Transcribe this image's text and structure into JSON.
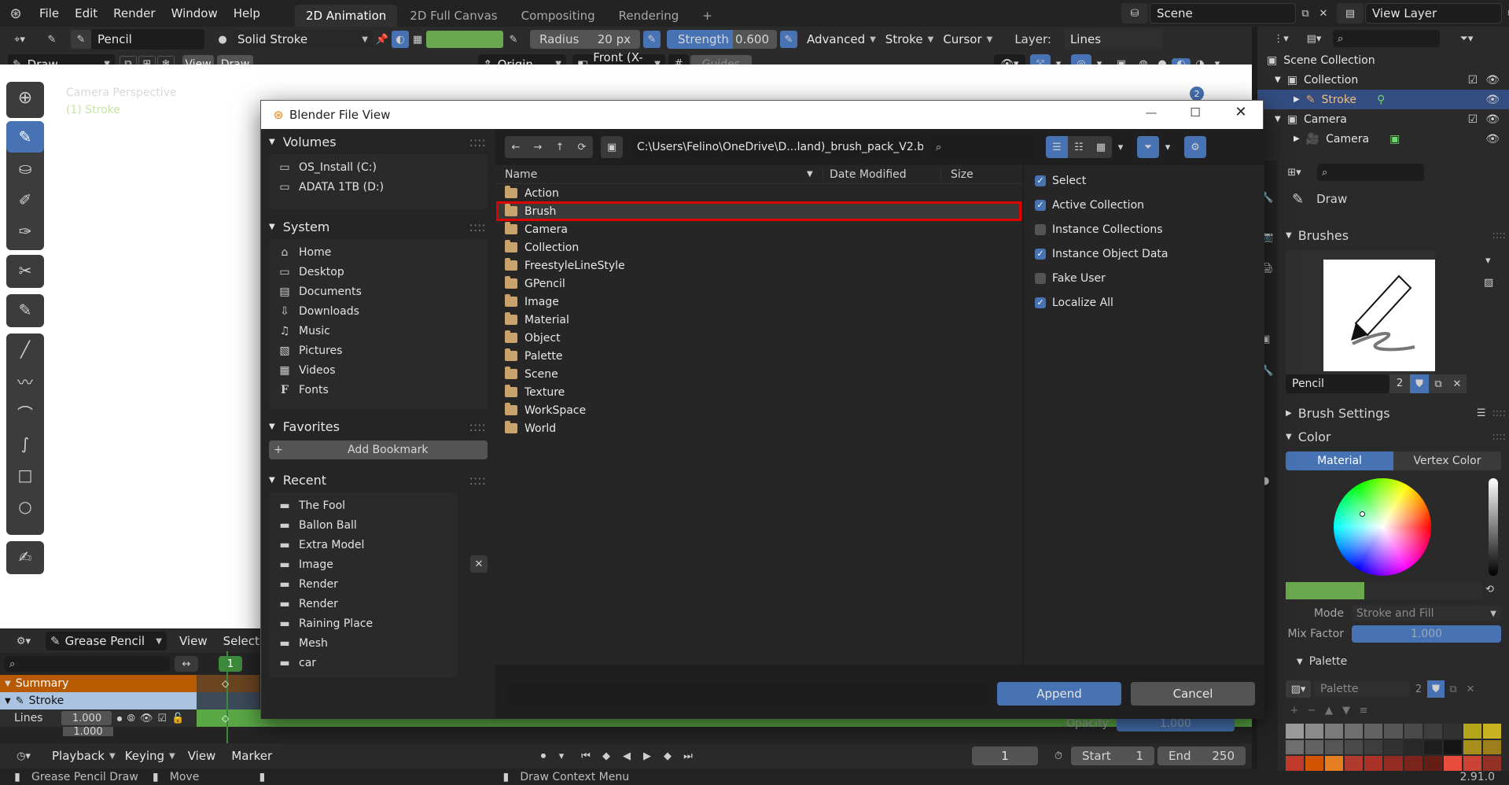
{
  "topbar": {
    "menus": [
      "File",
      "Edit",
      "Render",
      "Window",
      "Help"
    ],
    "workspaces": [
      {
        "label": "2D Animation",
        "active": true
      },
      {
        "label": "2D Full Canvas",
        "active": false
      },
      {
        "label": "Compositing",
        "active": false
      },
      {
        "label": "Rendering",
        "active": false
      }
    ],
    "add_tab": "+",
    "scene": "Scene",
    "view_layer": "View Layer"
  },
  "toolbar": {
    "brush_name": "Pencil",
    "material": "Solid Stroke",
    "radius_label": "Radius",
    "radius_value": "20 px",
    "strength_label": "Strength",
    "strength_value": "0.600",
    "advanced": "Advanced",
    "stroke": "Stroke",
    "cursor": "Cursor",
    "layer_label": "Layer:",
    "layer_value": "Lines",
    "brush_color": "#6aa84f",
    "accent": "#4772b3"
  },
  "viewport_header": {
    "mode": "Draw",
    "view": "View",
    "draw": "Draw",
    "origin": "Origin",
    "front": "Front (X-Z)",
    "guides": "Guides"
  },
  "viewport": {
    "camera_label": "Camera Perspective",
    "object_label": "(1) Stroke",
    "badge": "2"
  },
  "dialog": {
    "title": "Blender File View",
    "path": "C:\\Users\\Felino\\OneDrive\\D...land)_brush_pack_V2.blend\\",
    "volumes_title": "Volumes",
    "volumes": [
      "OS_Install (C:)",
      "ADATA 1TB (D:)"
    ],
    "system_title": "System",
    "system": [
      "Home",
      "Desktop",
      "Documents",
      "Downloads",
      "Music",
      "Pictures",
      "Videos",
      "Fonts"
    ],
    "favorites_title": "Favorites",
    "add_bookmark": "Add Bookmark",
    "recent_title": "Recent",
    "recent": [
      "The Fool",
      "Ballon Ball",
      "Extra Model",
      "Image",
      "Render",
      "Render",
      "Raining Place",
      "Mesh",
      "car"
    ],
    "columns": {
      "name": "Name",
      "date": "Date Modified",
      "size": "Size"
    },
    "files": [
      "Action",
      "Brush",
      "Camera",
      "Collection",
      "FreestyleLineStyle",
      "GPencil",
      "Image",
      "Material",
      "Object",
      "Palette",
      "Scene",
      "Texture",
      "WorkSpace",
      "World"
    ],
    "highlighted": "Brush",
    "options": [
      {
        "label": "Select",
        "checked": true
      },
      {
        "label": "Active Collection",
        "checked": true
      },
      {
        "label": "Instance Collections",
        "checked": false
      },
      {
        "label": "Instance Object Data",
        "checked": true
      },
      {
        "label": "Fake User",
        "checked": false
      },
      {
        "label": "Localize All",
        "checked": true
      }
    ],
    "filename_value": "",
    "append": "Append",
    "cancel": "Cancel"
  },
  "outliner": {
    "root": "Scene Collection",
    "collection": "Collection",
    "stroke": "Stroke",
    "camera_coll": "Camera",
    "camera": "Camera"
  },
  "properties": {
    "tool": "Draw",
    "brushes": "Brushes",
    "brush_name": "Pencil",
    "brush_users": "2",
    "brush_settings": "Brush Settings",
    "color": "Color",
    "material_tab": "Material",
    "vertex_tab": "Vertex Color",
    "mode_label": "Mode",
    "mode_value": "Stroke and Fill",
    "mix_label": "Mix Factor",
    "mix_value": "1.000",
    "palette_title": "Palette",
    "palette_name": "Palette",
    "palette_users": "2",
    "opacity_label": "Opacity",
    "opacity_value": "1.000"
  },
  "dopesheet": {
    "mode": "Grease Pencil",
    "view": "View",
    "select": "Select",
    "frame": "1",
    "summary": "Summary",
    "stroke": "Stroke",
    "lines": "Lines",
    "lines_value": "1.000",
    "fills_value": "1.000"
  },
  "timeline": {
    "playback": "Playback",
    "keying": "Keying",
    "view": "View",
    "marker": "Marker",
    "current": "1",
    "start_label": "Start",
    "start": "1",
    "end_label": "End",
    "end": "250"
  },
  "status": {
    "left": "Grease Pencil Draw",
    "move": "Move",
    "context": "Draw Context Menu",
    "version": "2.91.0"
  }
}
